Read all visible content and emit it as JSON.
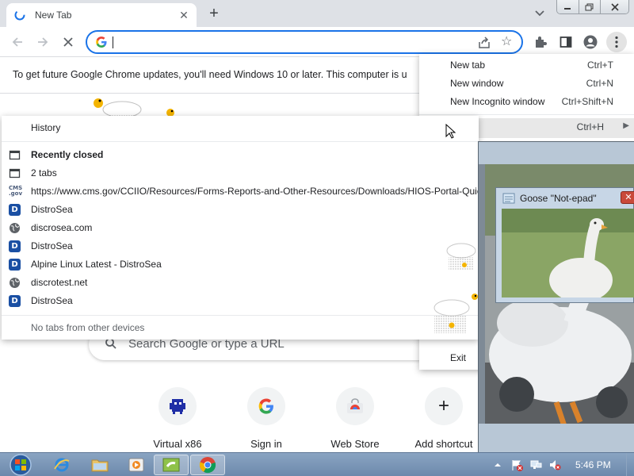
{
  "browser": {
    "tab": {
      "title": "New Tab",
      "close_symbol": "✕"
    },
    "new_tab_symbol": "+",
    "omnibox": {
      "value": ""
    }
  },
  "infobar": {
    "text": "To get future Google Chrome updates, you'll need Windows 10 or later. This computer is u"
  },
  "chrome_menu": {
    "items": [
      {
        "label": "New tab",
        "shortcut": "Ctrl+T"
      },
      {
        "label": "New window",
        "shortcut": "Ctrl+N"
      },
      {
        "label": "New Incognito window",
        "shortcut": "Ctrl+Shift+N"
      }
    ],
    "history": {
      "label": "History",
      "shortcut": "Ctrl+H",
      "arrow": "▶"
    },
    "exit_label": "Exit"
  },
  "history_menu": {
    "recently_closed_label": "Recently closed",
    "items": [
      {
        "label": "2 tabs",
        "icon": "window-icon"
      },
      {
        "label": "https://www.cms.gov/CCIIO/Resources/Forms-Reports-and-Other-Resources/Downloads/HIOS-Portal-Quic",
        "icon": "cms-favicon"
      },
      {
        "label": "DistroSea",
        "icon": "d-favicon"
      },
      {
        "label": "discrosea.com",
        "icon": "globe-icon"
      },
      {
        "label": "DistroSea",
        "icon": "d-favicon"
      },
      {
        "label": "Alpine Linux Latest - DistroSea",
        "icon": "d-favicon"
      },
      {
        "label": "discrotest.net",
        "icon": "globe-icon"
      },
      {
        "label": "DistroSea",
        "icon": "d-favicon"
      }
    ],
    "footer": "No tabs from other devices"
  },
  "ntp": {
    "search_placeholder": "Search Google or type a URL",
    "shortcuts": [
      {
        "label": "Virtual x86"
      },
      {
        "label": "Sign in"
      },
      {
        "label": "Web Store"
      },
      {
        "label": "Add shortcut"
      }
    ],
    "add_symbol": "+"
  },
  "goose_window": {
    "title": "Goose \"Not-epad\"",
    "close_symbol": "✕"
  },
  "taskbar": {
    "clock": "5:46 PM"
  },
  "colors": {
    "accent": "#1a73e8",
    "tabstrip": "#dee1e6",
    "taskbar": "#6d89ac",
    "distrosea_badge": "#1a4fa3"
  }
}
